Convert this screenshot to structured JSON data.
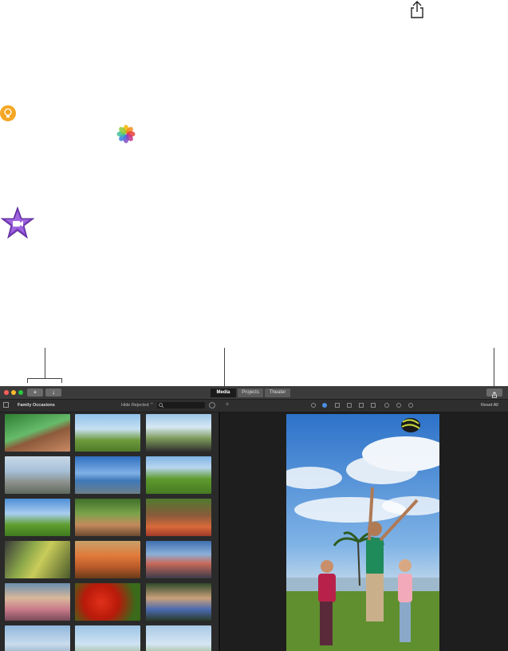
{
  "toolbar": {
    "add_label": "+",
    "import_label": "↓",
    "tabs": [
      {
        "label": "Media",
        "active": true
      },
      {
        "label": "Projects",
        "active": false
      },
      {
        "label": "Theater",
        "active": false
      }
    ]
  },
  "browser": {
    "library_title": "Family Occasions",
    "filter_label": "Hide Rejected ⌃"
  },
  "viewer": {
    "reset_label": "Reset All"
  },
  "icons": {
    "share": "share-icon",
    "tip": "lightbulb-icon",
    "photos": "photos-app-icon",
    "imovie": "imovie-app-icon"
  },
  "colors": {
    "accent": "#4a90e2",
    "tip": "#f5a623",
    "imovie": "#7b3fbf"
  }
}
